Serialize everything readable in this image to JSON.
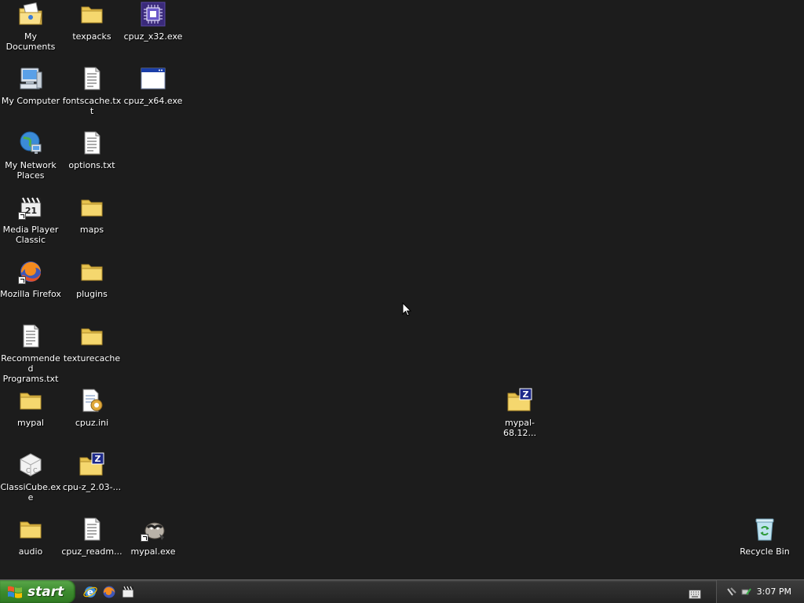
{
  "desktop": {
    "icons": [
      {
        "label": "My Documents",
        "icon": "my-documents-icon"
      },
      {
        "label": "texpacks",
        "icon": "folder-icon"
      },
      {
        "label": "cpuz_x32.exe",
        "icon": "cpuz-icon"
      },
      {
        "label": "My Computer",
        "icon": "my-computer-icon"
      },
      {
        "label": "fontscache.txt",
        "icon": "text-file-icon"
      },
      {
        "label": "cpuz_x64.exe",
        "icon": "window-app-icon"
      },
      {
        "label": "My Network Places",
        "icon": "network-places-icon"
      },
      {
        "label": "options.txt",
        "icon": "text-file-icon"
      },
      {
        "label": "Media Player Classic",
        "icon": "media-player-classic-icon"
      },
      {
        "label": "maps",
        "icon": "folder-icon"
      },
      {
        "label": "Mozilla Firefox",
        "icon": "firefox-icon"
      },
      {
        "label": "plugins",
        "icon": "folder-icon"
      },
      {
        "label": "Recommended Programs.txt",
        "icon": "text-file-icon"
      },
      {
        "label": "texturecache",
        "icon": "folder-icon"
      },
      {
        "label": "mypal",
        "icon": "folder-icon"
      },
      {
        "label": "cpuz.ini",
        "icon": "ini-file-icon"
      },
      {
        "label": "mypal-68.12...",
        "icon": "zip-folder-icon"
      },
      {
        "label": "ClassiCube.exe",
        "icon": "classicube-icon"
      },
      {
        "label": "cpu-z_2.03-...",
        "icon": "zip-folder-icon"
      },
      {
        "label": "audio",
        "icon": "folder-icon"
      },
      {
        "label": "cpuz_readm...",
        "icon": "text-file-icon"
      },
      {
        "label": "mypal.exe",
        "icon": "mypal-icon"
      },
      {
        "label": "Recycle Bin",
        "icon": "recycle-bin-icon"
      }
    ]
  },
  "taskbar": {
    "start_label": "start",
    "quick_launch": [
      "internet-explorer-icon",
      "firefox-icon",
      "media-player-classic-icon"
    ],
    "tray": {
      "clock": "3:07 PM",
      "icons": [
        "network-icon",
        "safely-remove-icon"
      ]
    }
  },
  "colors": {
    "desktop_bg": "#1c1c1c",
    "start_green": "#3c8b2e",
    "folder_yellow": "#f5d76e"
  }
}
